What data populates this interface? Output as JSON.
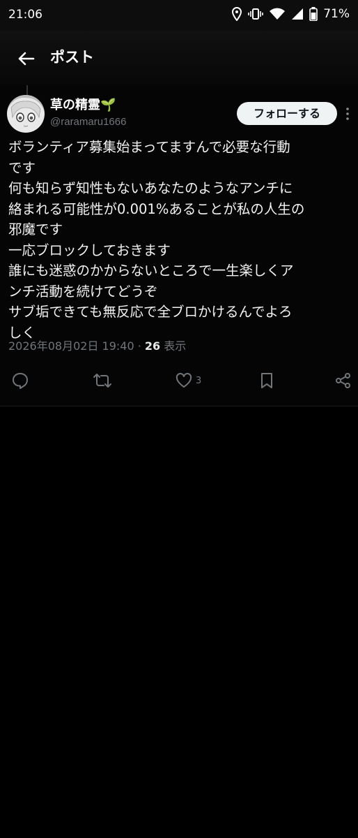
{
  "status_bar": {
    "time": "21:06",
    "battery": "71%"
  },
  "header": {
    "title": "ポスト"
  },
  "post": {
    "author_name": "草の精霊🌱",
    "handle": "@raramaru1666",
    "follow_label": "フォローする",
    "body_lines": [
      "ボランティア募集始まってますんで必要な行動",
      "です",
      "何も知らず知性もないあなたのようなアンチに",
      "絡まれる可能性が0.001%あることが私の人生の",
      "邪魔です",
      "一応ブロックしておきます",
      "誰にも迷惑のかからないところで一生楽しくア",
      "ンチ活動を続けてどうぞ",
      "サブ垢できても無反応で全ブロかけるんでよろ",
      "しく"
    ],
    "timestamp": "2026年08月02日 19:40",
    "separator": " · ",
    "views": "26",
    "views_label": " 表示",
    "likes": "3"
  },
  "colors": {
    "background": "#000000",
    "text": "#e7e9ea",
    "muted": "#71767b",
    "follow_bg": "#eff3f4"
  },
  "icons": [
    "back-arrow",
    "reply",
    "repost",
    "like",
    "bookmark",
    "share",
    "more-vertical"
  ]
}
